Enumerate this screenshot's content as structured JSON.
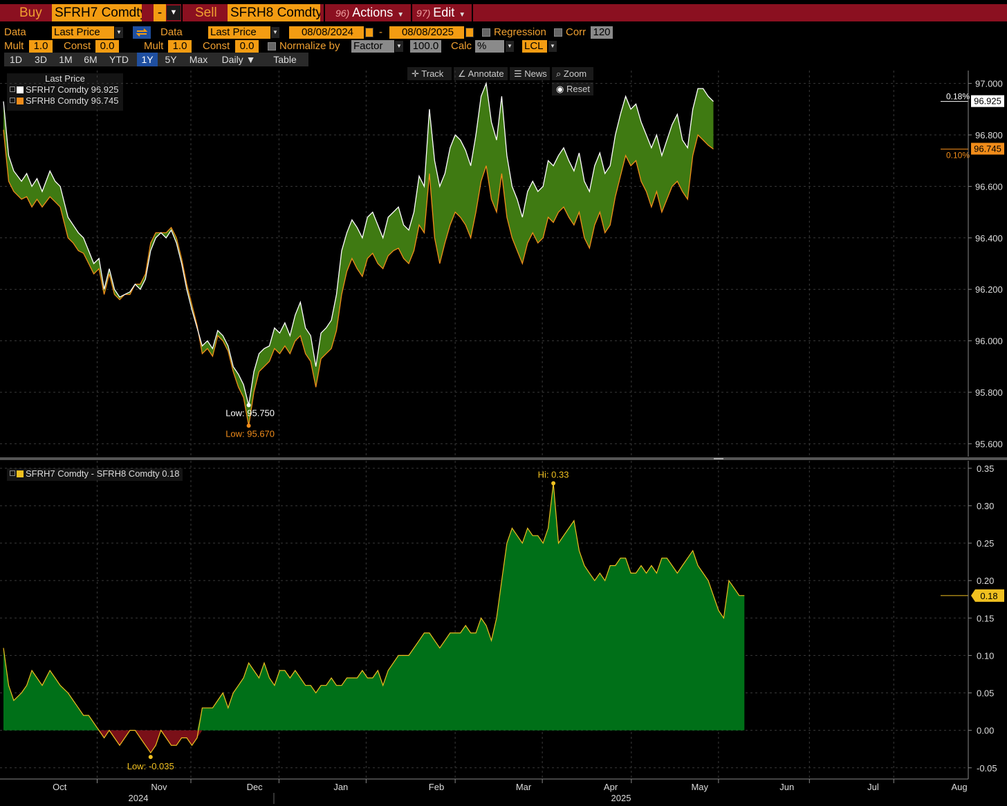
{
  "toolbar": {
    "buy_label": "Buy",
    "buy_ticker": "SFRH7 Comdty",
    "op": "-",
    "sell_label": "Sell",
    "sell_ticker": "SFRH8 Comdty",
    "actions_num": "96)",
    "actions_label": "Actions",
    "edit_num": "97)",
    "edit_label": "Edit"
  },
  "settings": {
    "data1_label": "Data",
    "data1_value": "Last Price",
    "data2_label": "Data",
    "data2_value": "Last Price",
    "start_date": "08/08/2024",
    "date_sep": "-",
    "end_date": "08/08/2025",
    "regression_label": "Regression",
    "corr_label": "Corr",
    "corr_value": "120",
    "mult1_label": "Mult",
    "mult1_value": "1.0",
    "const1_label": "Const",
    "const1_value": "0.0",
    "mult2_label": "Mult",
    "mult2_value": "1.0",
    "const2_label": "Const",
    "const2_value": "0.0",
    "normalize_label": "Normalize by",
    "normalize_value": "Factor",
    "normalize_amount": "100.0",
    "calc_label": "Calc",
    "calc_value": "%",
    "currency_value": "LCL"
  },
  "tabs": [
    {
      "label": "1D"
    },
    {
      "label": "3D"
    },
    {
      "label": "1M"
    },
    {
      "label": "6M"
    },
    {
      "label": "YTD"
    },
    {
      "label": "1Y"
    },
    {
      "label": "5Y"
    },
    {
      "label": "Max"
    },
    {
      "label": "Daily ▼"
    },
    {
      "label": "Table"
    }
  ],
  "active_tab": "1Y",
  "chart_tools": {
    "track": "Track",
    "annotate": "Annotate",
    "news": "News",
    "zoom": "Zoom",
    "reset": "Reset"
  },
  "legend_top": {
    "title": "Last Price",
    "series": [
      {
        "name": "SFRH7 Comdty",
        "value": "96.925",
        "color": "#ffffff"
      },
      {
        "name": "SFRH8 Comdty",
        "value": "96.745",
        "color": "#f08c1a"
      }
    ]
  },
  "legend_bottom": {
    "name": "SFRH7 Comdty - SFRH8 Comdty",
    "value": "0.18",
    "color": "#f0c020"
  },
  "colors": {
    "spread_positive": "#007018",
    "spread_negative": "#7a1018",
    "band_fill": "#3f7a12",
    "sfrh7": "#ffffff",
    "sfrh8": "#f08c1a",
    "spread_line": "#f0c020",
    "grid": "#555555"
  },
  "chart_data": [
    {
      "type": "line",
      "ylabel": "",
      "ylim": [
        95.55,
        97.05
      ],
      "yticks": [
        "97.000",
        "96.800",
        "96.600",
        "96.400",
        "96.200",
        "96.000",
        "95.800",
        "95.600"
      ],
      "ytick_values": [
        97.0,
        96.8,
        96.6,
        96.4,
        96.2,
        96.0,
        95.8,
        95.6
      ],
      "x": [
        0,
        2,
        4,
        7,
        9,
        11,
        13,
        15,
        18,
        20,
        22,
        25,
        27,
        29,
        31,
        33,
        35,
        37,
        39,
        41,
        43,
        45,
        47,
        49,
        51,
        53,
        55,
        57,
        59,
        61,
        63,
        65,
        67,
        69,
        71,
        73,
        75,
        77,
        79,
        81,
        83,
        85,
        87,
        89,
        91,
        93,
        95,
        97,
        99,
        101,
        103,
        105,
        107,
        109,
        111,
        113,
        115,
        117,
        119,
        121,
        123,
        125,
        127,
        129,
        131,
        133,
        135,
        137,
        139,
        141,
        143,
        145,
        147,
        149,
        151,
        153,
        155,
        157,
        159,
        161,
        163,
        165,
        167,
        169,
        171,
        173,
        175,
        177,
        179,
        181,
        183,
        185,
        187,
        189,
        191,
        193,
        195,
        197,
        199,
        201,
        203,
        205,
        207,
        209,
        211,
        213,
        215,
        217,
        219,
        221,
        223,
        225,
        227,
        229,
        231,
        233,
        235,
        237,
        239,
        241,
        243,
        245,
        247,
        249,
        251,
        253,
        255,
        257,
        259,
        261,
        263,
        265,
        267,
        269,
        271,
        273,
        275,
        277,
        279,
        281,
        283,
        285,
        287,
        289,
        291,
        293,
        295,
        297,
        299,
        301,
        303,
        305,
        307,
        309,
        311,
        313,
        315,
        317,
        319,
        321,
        323,
        325,
        327,
        329,
        331,
        333,
        335,
        337,
        339,
        341,
        343,
        345,
        347,
        349,
        351,
        353,
        355,
        357,
        359,
        361,
        363
      ],
      "series": [
        {
          "name": "SFRH7 Comdty",
          "color": "#ffffff",
          "values": [
            96.93,
            96.72,
            96.66,
            96.62,
            96.65,
            96.6,
            96.63,
            96.58,
            96.66,
            96.62,
            96.6,
            96.48,
            96.45,
            96.42,
            96.4,
            96.35,
            96.3,
            96.32,
            96.2,
            96.28,
            96.2,
            96.17,
            96.18,
            96.19,
            96.22,
            96.2,
            96.24,
            96.35,
            96.4,
            96.42,
            96.4,
            96.43,
            96.38,
            96.3,
            96.2,
            96.12,
            96.05,
            95.98,
            96.0,
            95.97,
            96.04,
            96.02,
            95.98,
            95.9,
            95.87,
            95.83,
            95.75,
            95.88,
            95.95,
            95.97,
            95.98,
            96.05,
            96.03,
            96.07,
            96.02,
            96.1,
            96.15,
            96.05,
            96.02,
            95.9,
            96.03,
            96.05,
            96.08,
            96.18,
            96.35,
            96.42,
            96.47,
            96.44,
            96.4,
            96.48,
            96.5,
            96.45,
            96.4,
            96.48,
            96.5,
            96.52,
            96.45,
            96.43,
            96.5,
            96.64,
            96.6,
            96.9,
            96.7,
            96.6,
            96.65,
            96.75,
            96.8,
            96.78,
            96.74,
            96.68,
            96.8,
            96.95,
            97.0,
            96.85,
            96.78,
            96.95,
            96.72,
            96.6,
            96.55,
            96.48,
            96.58,
            96.62,
            96.58,
            96.6,
            96.7,
            96.68,
            96.72,
            96.75,
            96.7,
            96.66,
            96.73,
            96.62,
            96.58,
            96.68,
            96.73,
            96.65,
            96.68,
            96.8,
            96.88,
            96.95,
            96.9,
            96.92,
            96.85,
            96.8,
            96.75,
            96.8,
            96.72,
            96.78,
            96.84,
            96.88,
            96.78,
            96.75,
            96.9,
            96.98,
            96.98,
            96.95,
            96.93
          ],
          "note_unused": ""
        },
        {
          "name": "SFRH8 Comdty",
          "color": "#f08c1a",
          "values": [
            96.82,
            96.62,
            96.58,
            96.55,
            96.56,
            96.52,
            96.55,
            96.52,
            96.56,
            96.54,
            96.52,
            96.4,
            96.38,
            96.35,
            96.34,
            96.3,
            96.26,
            96.28,
            96.18,
            96.26,
            96.18,
            96.16,
            96.18,
            96.18,
            96.22,
            96.22,
            96.26,
            96.38,
            96.42,
            96.42,
            96.42,
            96.44,
            96.4,
            96.32,
            96.22,
            96.14,
            96.06,
            95.95,
            95.97,
            95.94,
            96.02,
            96.0,
            95.96,
            95.88,
            95.82,
            95.78,
            95.67,
            95.8,
            95.88,
            95.9,
            95.92,
            95.97,
            95.95,
            95.98,
            95.95,
            96.0,
            96.02,
            95.95,
            95.92,
            95.82,
            95.93,
            95.95,
            95.97,
            96.04,
            96.18,
            96.27,
            96.32,
            96.28,
            96.25,
            96.32,
            96.34,
            96.3,
            96.28,
            96.33,
            96.35,
            96.36,
            96.32,
            96.3,
            96.35,
            96.45,
            96.42,
            96.65,
            96.4,
            96.3,
            96.38,
            96.45,
            96.5,
            96.48,
            96.45,
            96.4,
            96.5,
            96.62,
            96.68,
            96.55,
            96.5,
            96.65,
            96.48,
            96.4,
            96.35,
            96.3,
            96.38,
            96.42,
            96.38,
            96.4,
            96.48,
            96.46,
            96.5,
            96.52,
            96.48,
            96.45,
            96.5,
            96.4,
            96.36,
            96.45,
            96.5,
            96.42,
            96.45,
            96.56,
            96.64,
            96.72,
            96.68,
            96.7,
            96.62,
            96.58,
            96.52,
            96.58,
            96.5,
            96.55,
            96.6,
            96.62,
            96.58,
            96.55,
            96.72,
            96.8,
            96.78,
            96.76,
            96.745
          ]
        }
      ],
      "annotations": [
        {
          "text": "Low: 95.750",
          "series": "SFRH7 Comdty"
        },
        {
          "text": "Low: 95.670",
          "series": "SFRH8 Comdty"
        }
      ],
      "end_labels": {
        "sfrh7_pct": "0.18%",
        "sfrh7_last": "96.925",
        "sfrh8_pct": "0.10%",
        "sfrh8_last": "96.745"
      }
    },
    {
      "type": "area",
      "ylim": [
        -0.065,
        0.36
      ],
      "yticks": [
        "0.35",
        "0.30",
        "0.25",
        "0.20",
        "0.15",
        "0.10",
        "0.05",
        "0.00",
        "-0.05"
      ],
      "ytick_values": [
        0.35,
        0.3,
        0.25,
        0.2,
        0.15,
        0.1,
        0.05,
        0.0,
        -0.05
      ],
      "series": [
        {
          "name": "SFRH7 Comdty - SFRH8 Comdty",
          "color": "#f0c020",
          "values": [
            0.11,
            0.06,
            0.04,
            0.05,
            0.06,
            0.08,
            0.07,
            0.06,
            0.08,
            0.07,
            0.06,
            0.05,
            0.04,
            0.03,
            0.02,
            0.02,
            0.01,
            0.0,
            -0.01,
            0.0,
            -0.01,
            -0.02,
            -0.01,
            0.0,
            0.0,
            -0.01,
            -0.02,
            -0.03,
            -0.02,
            0.0,
            -0.01,
            -0.02,
            -0.02,
            -0.01,
            -0.01,
            -0.02,
            -0.01,
            0.03,
            0.03,
            0.03,
            0.04,
            0.05,
            0.03,
            0.05,
            0.06,
            0.07,
            0.09,
            0.08,
            0.07,
            0.09,
            0.07,
            0.06,
            0.08,
            0.08,
            0.07,
            0.08,
            0.07,
            0.06,
            0.06,
            0.05,
            0.06,
            0.06,
            0.07,
            0.06,
            0.06,
            0.07,
            0.07,
            0.07,
            0.08,
            0.07,
            0.07,
            0.08,
            0.06,
            0.08,
            0.09,
            0.1,
            0.1,
            0.1,
            0.11,
            0.12,
            0.13,
            0.13,
            0.12,
            0.11,
            0.12,
            0.13,
            0.13,
            0.13,
            0.14,
            0.13,
            0.13,
            0.15,
            0.14,
            0.12,
            0.15,
            0.2,
            0.25,
            0.27,
            0.26,
            0.25,
            0.27,
            0.26,
            0.26,
            0.25,
            0.27,
            0.33,
            0.25,
            0.26,
            0.27,
            0.28,
            0.24,
            0.22,
            0.21,
            0.2,
            0.21,
            0.2,
            0.22,
            0.22,
            0.23,
            0.23,
            0.21,
            0.21,
            0.22,
            0.21,
            0.22,
            0.21,
            0.23,
            0.23,
            0.22,
            0.21,
            0.22,
            0.23,
            0.24,
            0.22,
            0.21,
            0.2,
            0.18,
            0.16,
            0.15,
            0.2,
            0.19,
            0.18,
            0.18
          ]
        }
      ],
      "annotations": [
        {
          "text": "Hi: 0.33"
        },
        {
          "text": "Low: -0.035"
        }
      ],
      "end_label": "0.18"
    }
  ],
  "x_axis": {
    "months": [
      "Oct",
      "Nov",
      "Dec",
      "Jan",
      "Feb",
      "Mar",
      "Apr",
      "May",
      "Jun",
      "Jul",
      "Aug"
    ],
    "years": [
      "2024",
      "2025"
    ]
  }
}
